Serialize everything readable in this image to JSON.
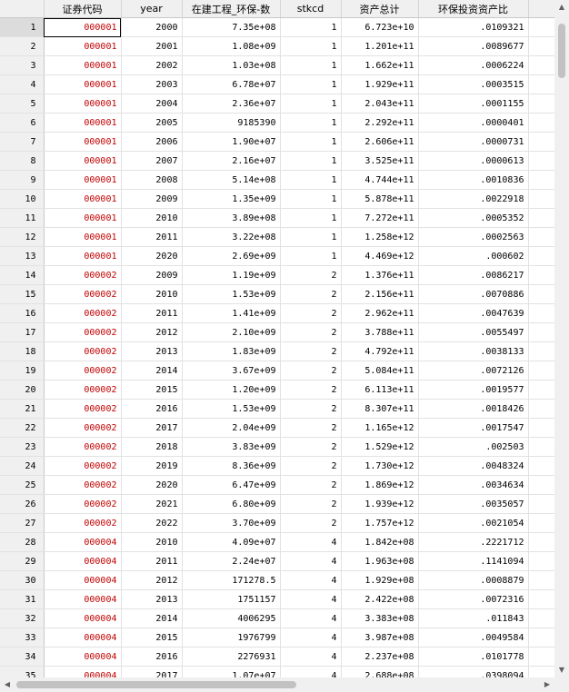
{
  "columns": [
    "证券代码",
    "year",
    "在建工程_环保-数",
    "stkcd",
    "资产总计",
    "环保投资资产比",
    ""
  ],
  "scroll_icons": {
    "up": "▲",
    "down": "▼",
    "left": "◀",
    "right": "▶"
  },
  "rows": [
    [
      "1",
      "000001",
      "2000",
      "7.35e+08",
      "1",
      "6.723e+10",
      ".0109321"
    ],
    [
      "2",
      "000001",
      "2001",
      "1.08e+09",
      "1",
      "1.201e+11",
      ".0089677"
    ],
    [
      "3",
      "000001",
      "2002",
      "1.03e+08",
      "1",
      "1.662e+11",
      ".0006224"
    ],
    [
      "4",
      "000001",
      "2003",
      "6.78e+07",
      "1",
      "1.929e+11",
      ".0003515"
    ],
    [
      "5",
      "000001",
      "2004",
      "2.36e+07",
      "1",
      "2.043e+11",
      ".0001155"
    ],
    [
      "6",
      "000001",
      "2005",
      "9185390",
      "1",
      "2.292e+11",
      ".0000401"
    ],
    [
      "7",
      "000001",
      "2006",
      "1.90e+07",
      "1",
      "2.606e+11",
      ".0000731"
    ],
    [
      "8",
      "000001",
      "2007",
      "2.16e+07",
      "1",
      "3.525e+11",
      ".0000613"
    ],
    [
      "9",
      "000001",
      "2008",
      "5.14e+08",
      "1",
      "4.744e+11",
      ".0010836"
    ],
    [
      "10",
      "000001",
      "2009",
      "1.35e+09",
      "1",
      "5.878e+11",
      ".0022918"
    ],
    [
      "11",
      "000001",
      "2010",
      "3.89e+08",
      "1",
      "7.272e+11",
      ".0005352"
    ],
    [
      "12",
      "000001",
      "2011",
      "3.22e+08",
      "1",
      "1.258e+12",
      ".0002563"
    ],
    [
      "13",
      "000001",
      "2020",
      "2.69e+09",
      "1",
      "4.469e+12",
      ".000602"
    ],
    [
      "14",
      "000002",
      "2009",
      "1.19e+09",
      "2",
      "1.376e+11",
      ".0086217"
    ],
    [
      "15",
      "000002",
      "2010",
      "1.53e+09",
      "2",
      "2.156e+11",
      ".0070886"
    ],
    [
      "16",
      "000002",
      "2011",
      "1.41e+09",
      "2",
      "2.962e+11",
      ".0047639"
    ],
    [
      "17",
      "000002",
      "2012",
      "2.10e+09",
      "2",
      "3.788e+11",
      ".0055497"
    ],
    [
      "18",
      "000002",
      "2013",
      "1.83e+09",
      "2",
      "4.792e+11",
      ".0038133"
    ],
    [
      "19",
      "000002",
      "2014",
      "3.67e+09",
      "2",
      "5.084e+11",
      ".0072126"
    ],
    [
      "20",
      "000002",
      "2015",
      "1.20e+09",
      "2",
      "6.113e+11",
      ".0019577"
    ],
    [
      "21",
      "000002",
      "2016",
      "1.53e+09",
      "2",
      "8.307e+11",
      ".0018426"
    ],
    [
      "22",
      "000002",
      "2017",
      "2.04e+09",
      "2",
      "1.165e+12",
      ".0017547"
    ],
    [
      "23",
      "000002",
      "2018",
      "3.83e+09",
      "2",
      "1.529e+12",
      ".002503"
    ],
    [
      "24",
      "000002",
      "2019",
      "8.36e+09",
      "2",
      "1.730e+12",
      ".0048324"
    ],
    [
      "25",
      "000002",
      "2020",
      "6.47e+09",
      "2",
      "1.869e+12",
      ".0034634"
    ],
    [
      "26",
      "000002",
      "2021",
      "6.80e+09",
      "2",
      "1.939e+12",
      ".0035057"
    ],
    [
      "27",
      "000002",
      "2022",
      "3.70e+09",
      "2",
      "1.757e+12",
      ".0021054"
    ],
    [
      "28",
      "000004",
      "2010",
      "4.09e+07",
      "4",
      "1.842e+08",
      ".2221712"
    ],
    [
      "29",
      "000004",
      "2011",
      "2.24e+07",
      "4",
      "1.963e+08",
      ".1141094"
    ],
    [
      "30",
      "000004",
      "2012",
      "171278.5",
      "4",
      "1.929e+08",
      ".0008879"
    ],
    [
      "31",
      "000004",
      "2013",
      "1751157",
      "4",
      "2.422e+08",
      ".0072316"
    ],
    [
      "32",
      "000004",
      "2014",
      "4006295",
      "4",
      "3.383e+08",
      ".011843"
    ],
    [
      "33",
      "000004",
      "2015",
      "1976799",
      "4",
      "3.987e+08",
      ".0049584"
    ],
    [
      "34",
      "000004",
      "2016",
      "2276931",
      "4",
      "2.237e+08",
      ".0101778"
    ],
    [
      "35",
      "000004",
      "2017",
      "1.07e+07",
      "4",
      "2.688e+08",
      ".0398094"
    ]
  ]
}
